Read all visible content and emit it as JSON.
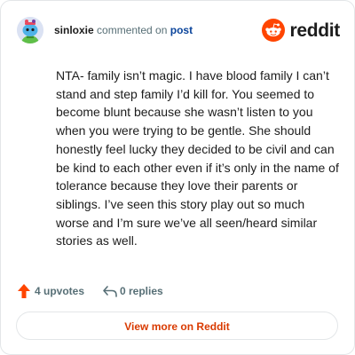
{
  "header": {
    "username": "sinloxie",
    "action_text": " commented on ",
    "post_link": "post",
    "brand_name": "reddit"
  },
  "comment": {
    "body": "NTA- family isn’t magic. I have blood family I can’t stand and step family I’d kill for. You seemed to become blunt because she wasn’t listen to you when you were trying to be gentle. She should honestly feel lucky they decided to be civil and can be kind to each other even if it’s only in the name of tolerance because they love their parents or siblings. I’ve seen this story play out so much worse and I’m sure we’ve all seen/heard similar stories as well."
  },
  "stats": {
    "upvotes": "4 upvotes",
    "replies": "0 replies"
  },
  "footer": {
    "view_button": "View more on Reddit"
  },
  "icons": {
    "avatar": "snoo-avatar",
    "brand": "reddit-logo-icon",
    "upvote": "upvote-arrow-icon",
    "reply": "reply-arrow-icon"
  },
  "colors": {
    "brand_orange": "#ff4500",
    "upvote_orange": "#ff4500",
    "link_blue": "#0a449b",
    "button_text": "#d93a00",
    "muted_text": "#576f76",
    "border": "#e3e6e8"
  }
}
